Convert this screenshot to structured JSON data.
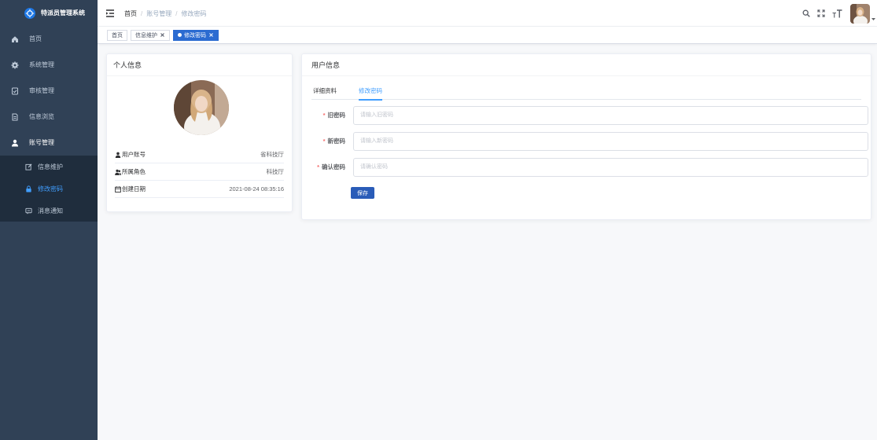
{
  "app": {
    "title": "特派员管理系统",
    "logo_icon": "logo-icon"
  },
  "sidebar": {
    "items": [
      {
        "label": "首页",
        "icon": "home-icon"
      },
      {
        "label": "系统管理",
        "icon": "gear-icon"
      },
      {
        "label": "审核管理",
        "icon": "audit-icon"
      },
      {
        "label": "信息浏览",
        "icon": "browse-icon"
      },
      {
        "label": "账号管理",
        "icon": "user-icon",
        "expanded": true,
        "children": [
          {
            "label": "信息维护",
            "icon": "edit-icon"
          },
          {
            "label": "修改密码",
            "icon": "lock-icon",
            "active": true
          },
          {
            "label": "消息通知",
            "icon": "message-icon"
          }
        ]
      }
    ]
  },
  "header": {
    "breadcrumb": [
      "首页",
      "账号管理",
      "修改密码"
    ],
    "separator": "/",
    "icons": [
      "hamburger-icon",
      "search-icon",
      "fullscreen-icon",
      "font-size-icon",
      "user-avatar",
      "caret-down-icon"
    ]
  },
  "tags": [
    {
      "label": "首页",
      "active": false,
      "closable": false
    },
    {
      "label": "信息维护",
      "active": false,
      "closable": true
    },
    {
      "label": "修改密码",
      "active": true,
      "closable": true
    }
  ],
  "profile": {
    "title": "个人信息",
    "rows": [
      {
        "label": "用户账号",
        "icon": "user-icon",
        "value": "省科技厅"
      },
      {
        "label": "所属角色",
        "icon": "peoples-icon",
        "value": "科技厅"
      },
      {
        "label": "创建日期",
        "icon": "date-icon",
        "value": "2021-08-24 08:35:16"
      }
    ]
  },
  "user_info": {
    "title": "用户信息",
    "tabs": [
      {
        "label": "详细资料",
        "active": false
      },
      {
        "label": "修改密码",
        "active": true
      }
    ],
    "form": {
      "required_mark": "*",
      "fields": [
        {
          "label": "旧密码",
          "placeholder": "请输入旧密码",
          "value": "",
          "required": true
        },
        {
          "label": "新密码",
          "placeholder": "请输入新密码",
          "value": "",
          "required": true
        },
        {
          "label": "确认密码",
          "placeholder": "请确认密码",
          "value": "",
          "required": true
        }
      ],
      "save_label": "保存"
    }
  },
  "colors": {
    "sidebar_bg": "#304156",
    "submenu_bg": "#1f2d3d",
    "menu_text": "#bfcbd9",
    "accent": "#409eff",
    "tag_active": "#2b6bd1",
    "button": "#2a5cb8",
    "required": "#f56c6c",
    "page_bg": "#f7f8fa"
  }
}
